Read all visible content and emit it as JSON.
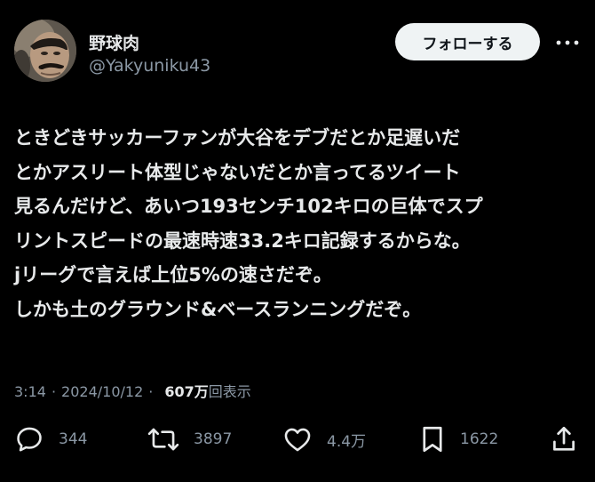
{
  "user": {
    "display_name": "野球肉",
    "handle": "@Yakyuniku43",
    "avatar_icon": "avatar-photo"
  },
  "follow_label": "フォローする",
  "more_icon": "more-icon",
  "tweet": {
    "lines": [
      "ときどきサッカーファンが大谷をデブだとか足遅いだ",
      "とかアスリート体型じゃないだとか言ってるツイート",
      "見るんだけど、あいつ193センチ102キロの巨体でスプ",
      "リントスピードの最速時速33.2キロ記録するからな。",
      "jリーグで言えば上位5%の速さだぞ。",
      "しかも土のグラウンド&ベースランニングだぞ。"
    ]
  },
  "meta": {
    "time": "3:14",
    "separator": "·",
    "date": "2024/10/12",
    "views_count": "607万",
    "views_label": "回表示"
  },
  "actions": {
    "replies": "344",
    "retweets": "3897",
    "likes": "4.4万",
    "bookmarks": "1622"
  },
  "colors": {
    "background": "#000000",
    "text": "#e7e9ea",
    "secondary": "#8b98a5",
    "follow_bg": "#eff3f4"
  }
}
